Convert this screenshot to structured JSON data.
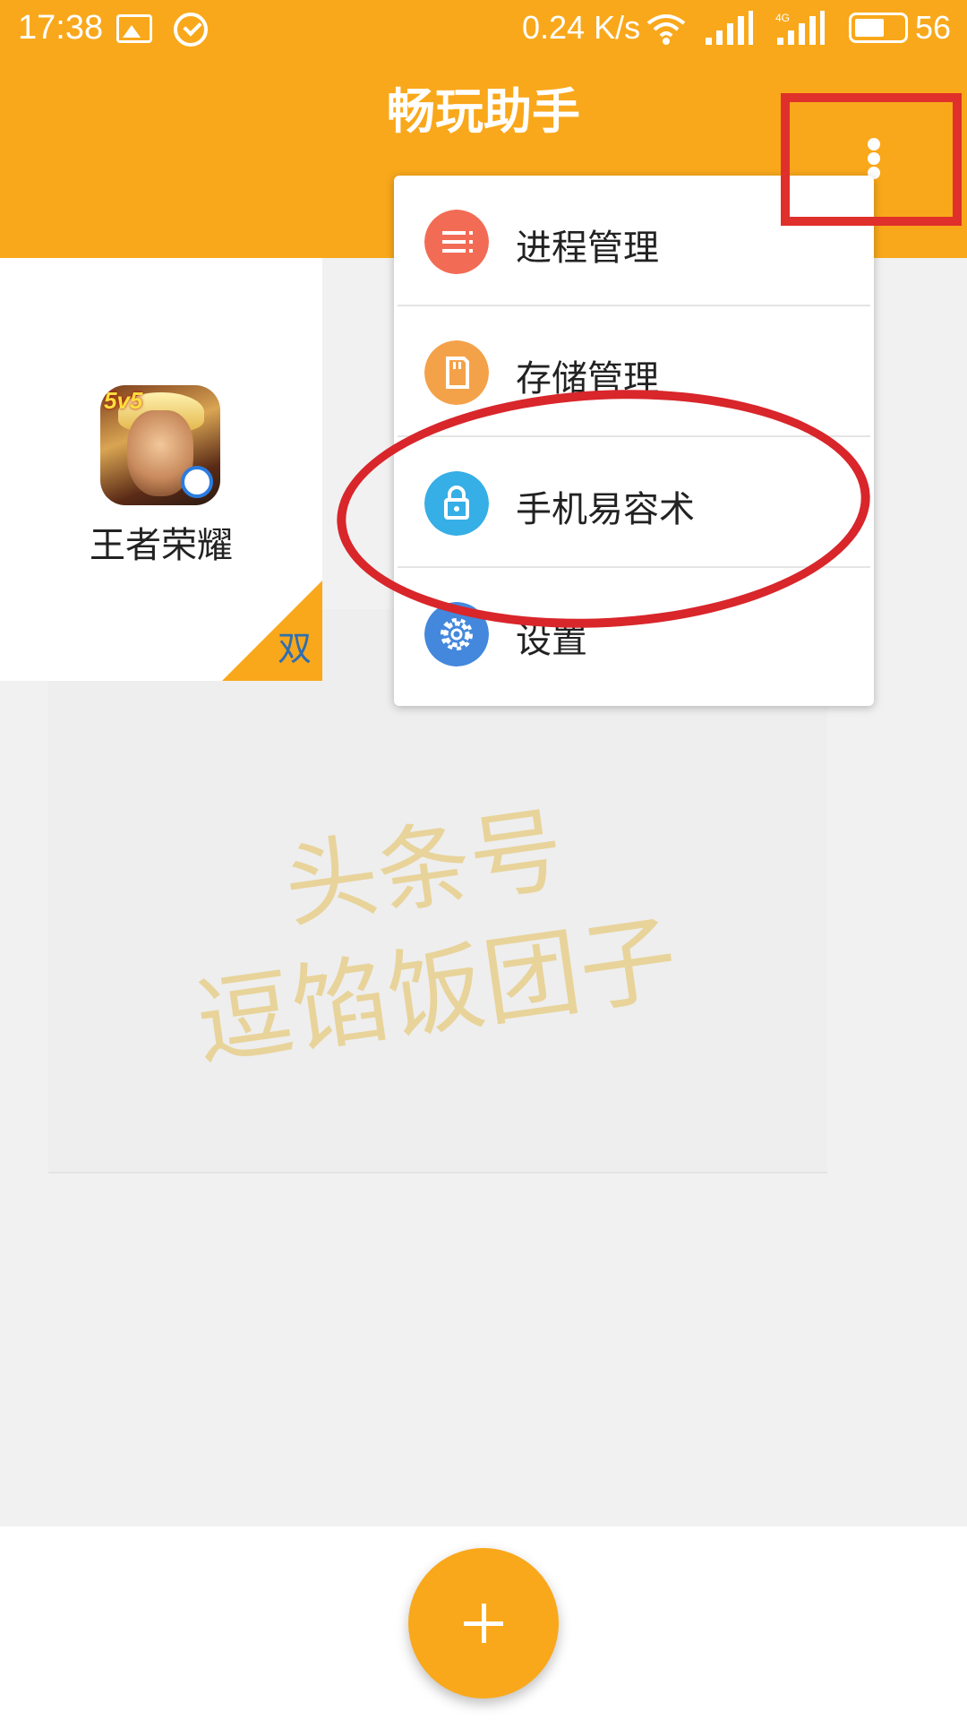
{
  "status_bar": {
    "time": "17:38",
    "net_speed": "0.24 K/s",
    "network_type": "4G",
    "battery": "56"
  },
  "app_bar": {
    "title": "畅玩助手",
    "overflow_icon": "more-vert-icon"
  },
  "game_card": {
    "name": "王者荣耀",
    "icon_badge": "5v5",
    "dual_label": "双"
  },
  "popup_menu": {
    "items": [
      {
        "label": "进程管理",
        "icon": "list-icon",
        "color": "#f26c55"
      },
      {
        "label": "存储管理",
        "icon": "sd-card-icon",
        "color": "#f4a24a"
      },
      {
        "label": "手机易容术",
        "icon": "lock-icon",
        "color": "#36aee6"
      },
      {
        "label": "设置",
        "icon": "gear-icon",
        "color": "#4488dd"
      }
    ]
  },
  "watermark": {
    "line1": "头条号",
    "line2": "逗馅饭团子"
  },
  "fab": {
    "icon": "plus-icon"
  },
  "colors": {
    "accent": "#f9a81b",
    "annotation": "#e0302b"
  }
}
